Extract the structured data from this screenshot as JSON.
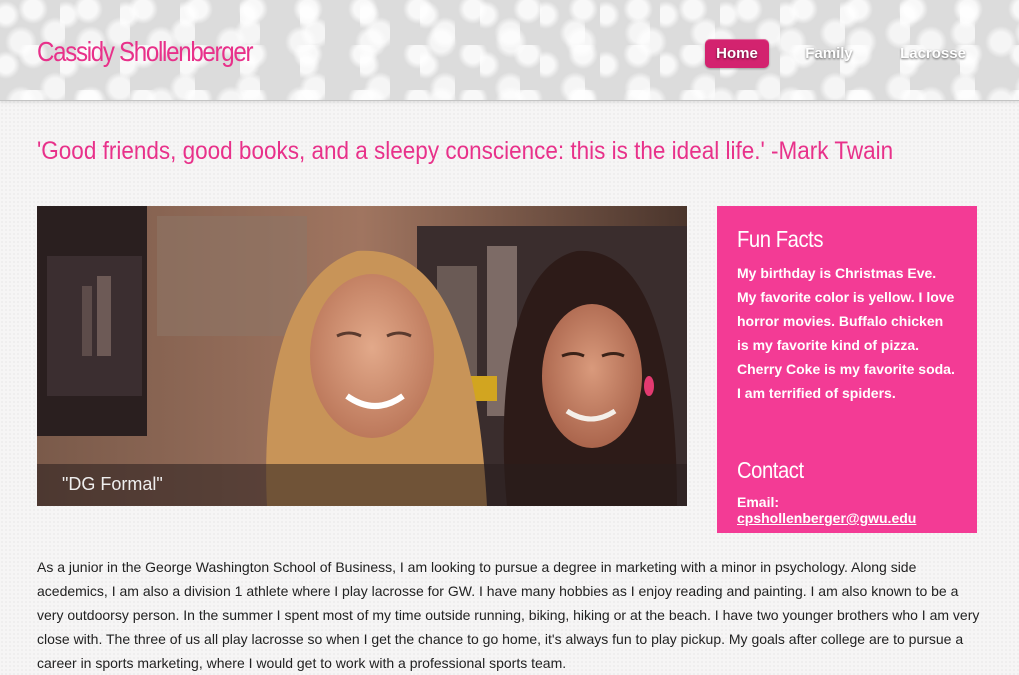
{
  "site": {
    "title": "Cassidy Shollenberger"
  },
  "nav": {
    "home": "Home",
    "family": "Family",
    "lacrosse": "Lacrosse"
  },
  "quote": "'Good friends, good books, and a sleepy conscience: this is the ideal life.' -Mark Twain",
  "photo": {
    "caption": "\"DG Formal\""
  },
  "sidebar": {
    "fun_facts_heading": "Fun Facts",
    "fun_facts_text": "My birthday is Christmas Eve. My favorite color is yellow. I love horror movies. Buffalo chicken is my favorite kind of pizza. Cherry Coke is my favorite soda. I am terrified of spiders.",
    "contact_heading": "Contact",
    "email_label": "Email:",
    "email": "cpshollenberger@gwu.edu"
  },
  "bio": "As a junior in the George Washington School of Business, I am looking to pursue a degree in marketing with a minor in psychology. Along side acedemics, I am also a division 1 athlete where I play lacrosse for GW. I have many hobbies as I enjoy reading and painting. I am also known to be a very outdoorsy person. In the summer I spent most of my time outside running, biking, hiking or at the beach. I have two younger brothers who I am very close with. The three of us all play lacrosse so when I get the chance to go home, it's always fun to play pickup. My goals after college are to pursue a career in sports marketing, where I would get to work with a professional sports team.",
  "colors": {
    "accent": "#e8318a",
    "sidebar": "#f33b95",
    "nav_active": "#d3236f"
  }
}
